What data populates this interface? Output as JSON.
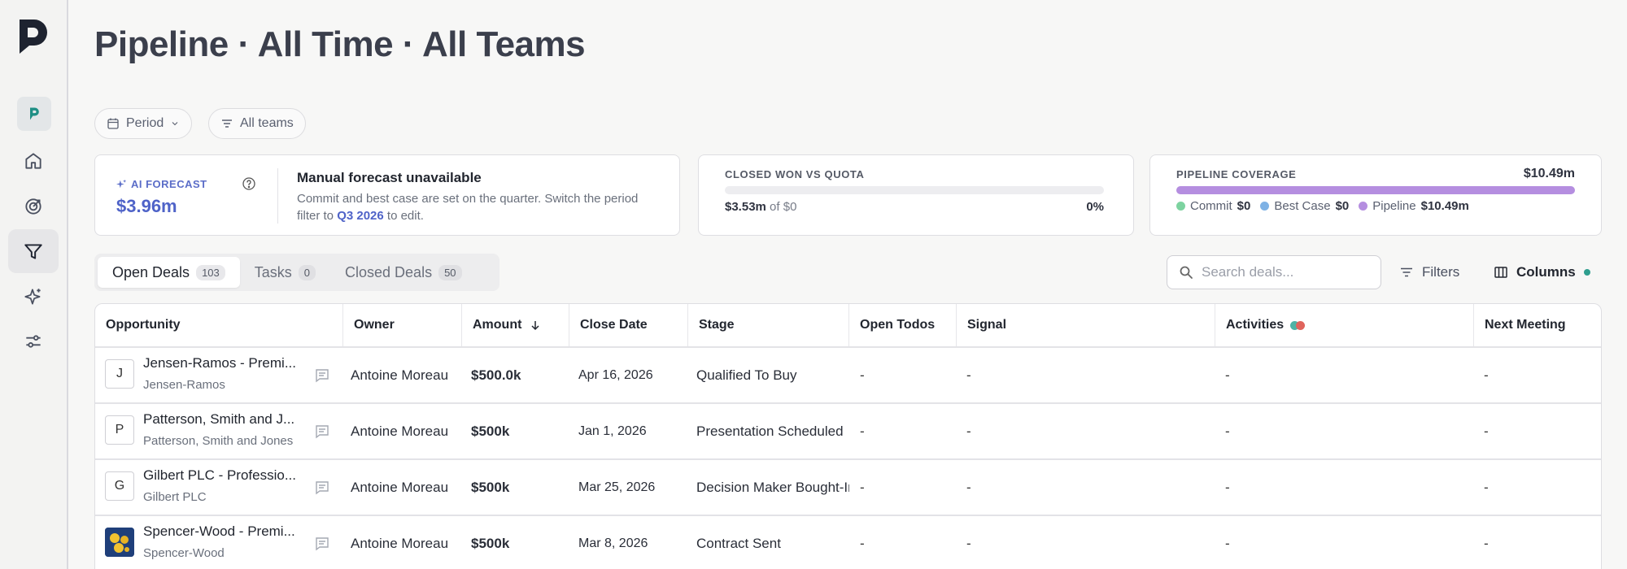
{
  "page": {
    "title": "Pipeline · All Time · All Teams"
  },
  "filters": {
    "period_label": "Period",
    "teams_label": "All teams"
  },
  "forecast": {
    "ai_label": "AI FORECAST",
    "ai_value": "$3.96m",
    "manual_title": "Manual forecast unavailable",
    "manual_desc_pre": "Commit and best case are set on the quarter. Switch the period filter to ",
    "manual_link": "Q3 2026",
    "manual_desc_post": " to edit."
  },
  "quota": {
    "label": "CLOSED WON VS QUOTA",
    "amount": "$3.53m",
    "of_text": "of $0",
    "percent": "0%",
    "fill_fraction": 0.0
  },
  "coverage": {
    "label": "PIPELINE COVERAGE",
    "total": "$10.49m",
    "legend": [
      {
        "name": "Commit",
        "value": "$0",
        "color": "#7dd3a0"
      },
      {
        "name": "Best Case",
        "value": "$0",
        "color": "#7fb2e5"
      },
      {
        "name": "Pipeline",
        "value": "$10.49m",
        "color": "#b58ee0"
      }
    ],
    "fill_fraction": 1.0
  },
  "tabs": [
    {
      "label": "Open Deals",
      "count": "103"
    },
    {
      "label": "Tasks",
      "count": "0"
    },
    {
      "label": "Closed Deals",
      "count": "50"
    }
  ],
  "search": {
    "placeholder": "Search deals..."
  },
  "toolbar": {
    "filters_label": "Filters",
    "columns_label": "Columns"
  },
  "table": {
    "headers": {
      "opportunity": "Opportunity",
      "owner": "Owner",
      "amount": "Amount",
      "close_date": "Close Date",
      "stage": "Stage",
      "open_todos": "Open Todos",
      "signal": "Signal",
      "activities": "Activities",
      "next_meeting": "Next Meeting"
    },
    "rows": [
      {
        "initial": "J",
        "name": "Jensen-Ramos - Premi...",
        "company": "Jensen-Ramos",
        "owner": "Antoine Moreau",
        "amount": "$500.0k",
        "close_date": "Apr 16, 2026",
        "stage": "Qualified To Buy",
        "open_todos": "-",
        "signal": "-",
        "activities": "-",
        "next_meeting": "-"
      },
      {
        "initial": "P",
        "name": "Patterson, Smith and J...",
        "company": "Patterson, Smith and Jones",
        "owner": "Antoine Moreau",
        "amount": "$500k",
        "close_date": "Jan 1, 2026",
        "stage": "Presentation Scheduled",
        "open_todos": "-",
        "signal": "-",
        "activities": "-",
        "next_meeting": "-"
      },
      {
        "initial": "G",
        "name": "Gilbert PLC - Professio...",
        "company": "Gilbert PLC",
        "owner": "Antoine Moreau",
        "amount": "$500k",
        "close_date": "Mar 25, 2026",
        "stage": "Decision Maker Bought-In",
        "open_todos": "-",
        "signal": "-",
        "activities": "-",
        "next_meeting": "-"
      },
      {
        "initial": "",
        "name": "Spencer-Wood - Premi...",
        "company": "Spencer-Wood",
        "owner": "Antoine Moreau",
        "amount": "$500k",
        "close_date": "Mar 8, 2026",
        "stage": "Contract Sent",
        "open_todos": "-",
        "signal": "-",
        "activities": "-",
        "next_meeting": "-"
      }
    ]
  },
  "colors": {
    "accent": "#4f63c8",
    "teal": "#2f9e8e",
    "activity_dot_a": "#4fb3a5",
    "activity_dot_b": "#e0645c"
  }
}
